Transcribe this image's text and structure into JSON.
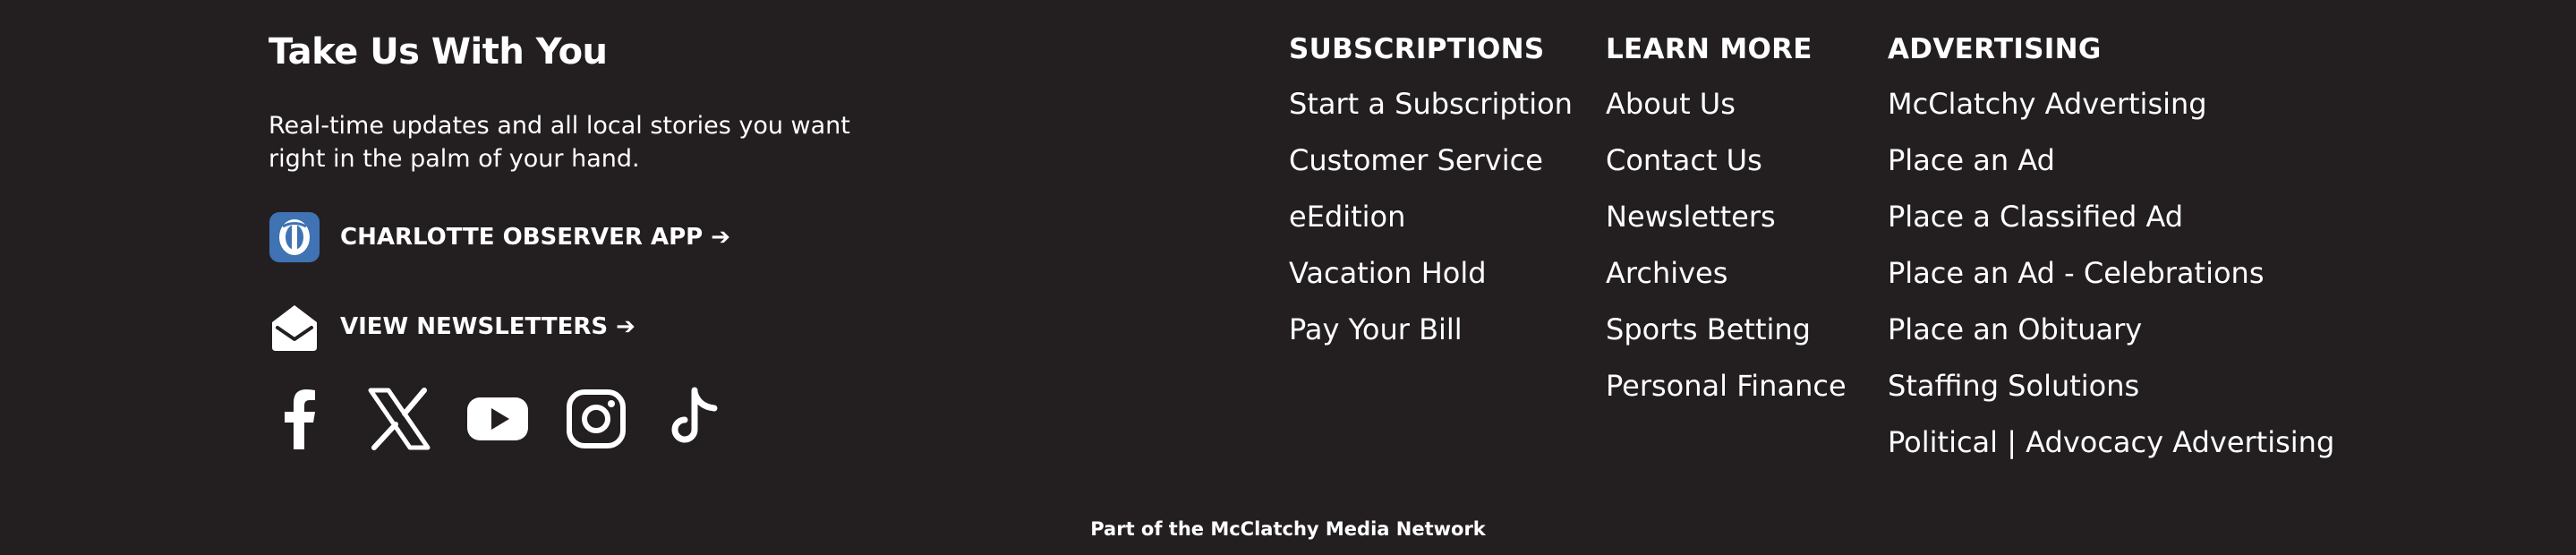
{
  "app_promo": {
    "heading": "Take Us With You",
    "text": "Real-time updates and all local stories you want right in the palm of your hand.",
    "app_link": "CHARLOTTE OBSERVER APP ➔",
    "newsletters_link": "VIEW NEWSLETTERS ➔",
    "app_icon_color": "#3f73b3"
  },
  "social": [
    {
      "network": "Facebook",
      "icon": "facebook-icon"
    },
    {
      "network": "X",
      "icon": "x-icon"
    },
    {
      "network": "YouTube",
      "icon": "youtube-icon"
    },
    {
      "network": "Instagram",
      "icon": "instagram-icon"
    },
    {
      "network": "TikTok",
      "icon": "tiktok-icon"
    }
  ],
  "columns": {
    "subscriptions": {
      "title": "SUBSCRIPTIONS",
      "links": [
        "Start a Subscription",
        "Customer Service",
        "eEdition",
        "Vacation Hold",
        "Pay Your Bill"
      ]
    },
    "learn_more": {
      "title": "LEARN MORE",
      "links": [
        "About Us",
        "Contact Us",
        "Newsletters",
        "Archives",
        "Sports Betting",
        "Personal Finance"
      ]
    },
    "advertising": {
      "title": "ADVERTISING",
      "links": [
        "McClatchy Advertising",
        "Place an Ad",
        "Place a Classified Ad",
        "Place an Ad - Celebrations",
        "Place an Obituary",
        "Staffing Solutions",
        "Political | Advocacy Advertising"
      ]
    }
  },
  "network_text": "Part of the McClatchy Media Network",
  "colors": {
    "background": "#231f20",
    "text": "#ffffff"
  }
}
